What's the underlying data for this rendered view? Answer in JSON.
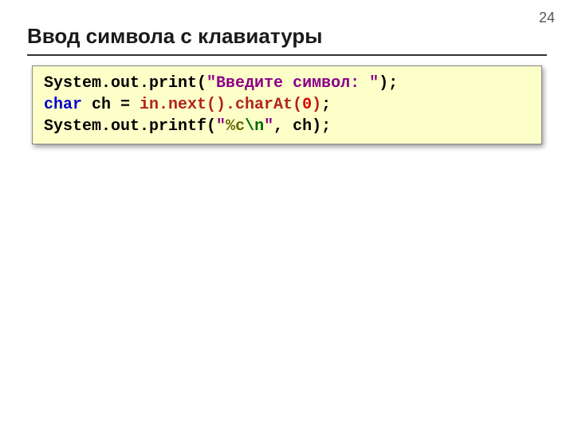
{
  "page_number": "24",
  "title": "Ввод символа с клавиатуры",
  "code": {
    "l1_a": "System.out.print(",
    "l1_b": "\"Введите символ: \"",
    "l1_c": ");",
    "l2_a": "char",
    "l2_b": " ch = ",
    "l2_c": "in.next().charAt(",
    "l2_d": "0",
    "l2_e": ")",
    "l2_f": ";",
    "l3_a": "System.out.printf(",
    "l3_b": "\"",
    "l3_c": "%c",
    "l3_d": "\\n",
    "l3_e": "\"",
    "l3_f": ", ch);"
  }
}
